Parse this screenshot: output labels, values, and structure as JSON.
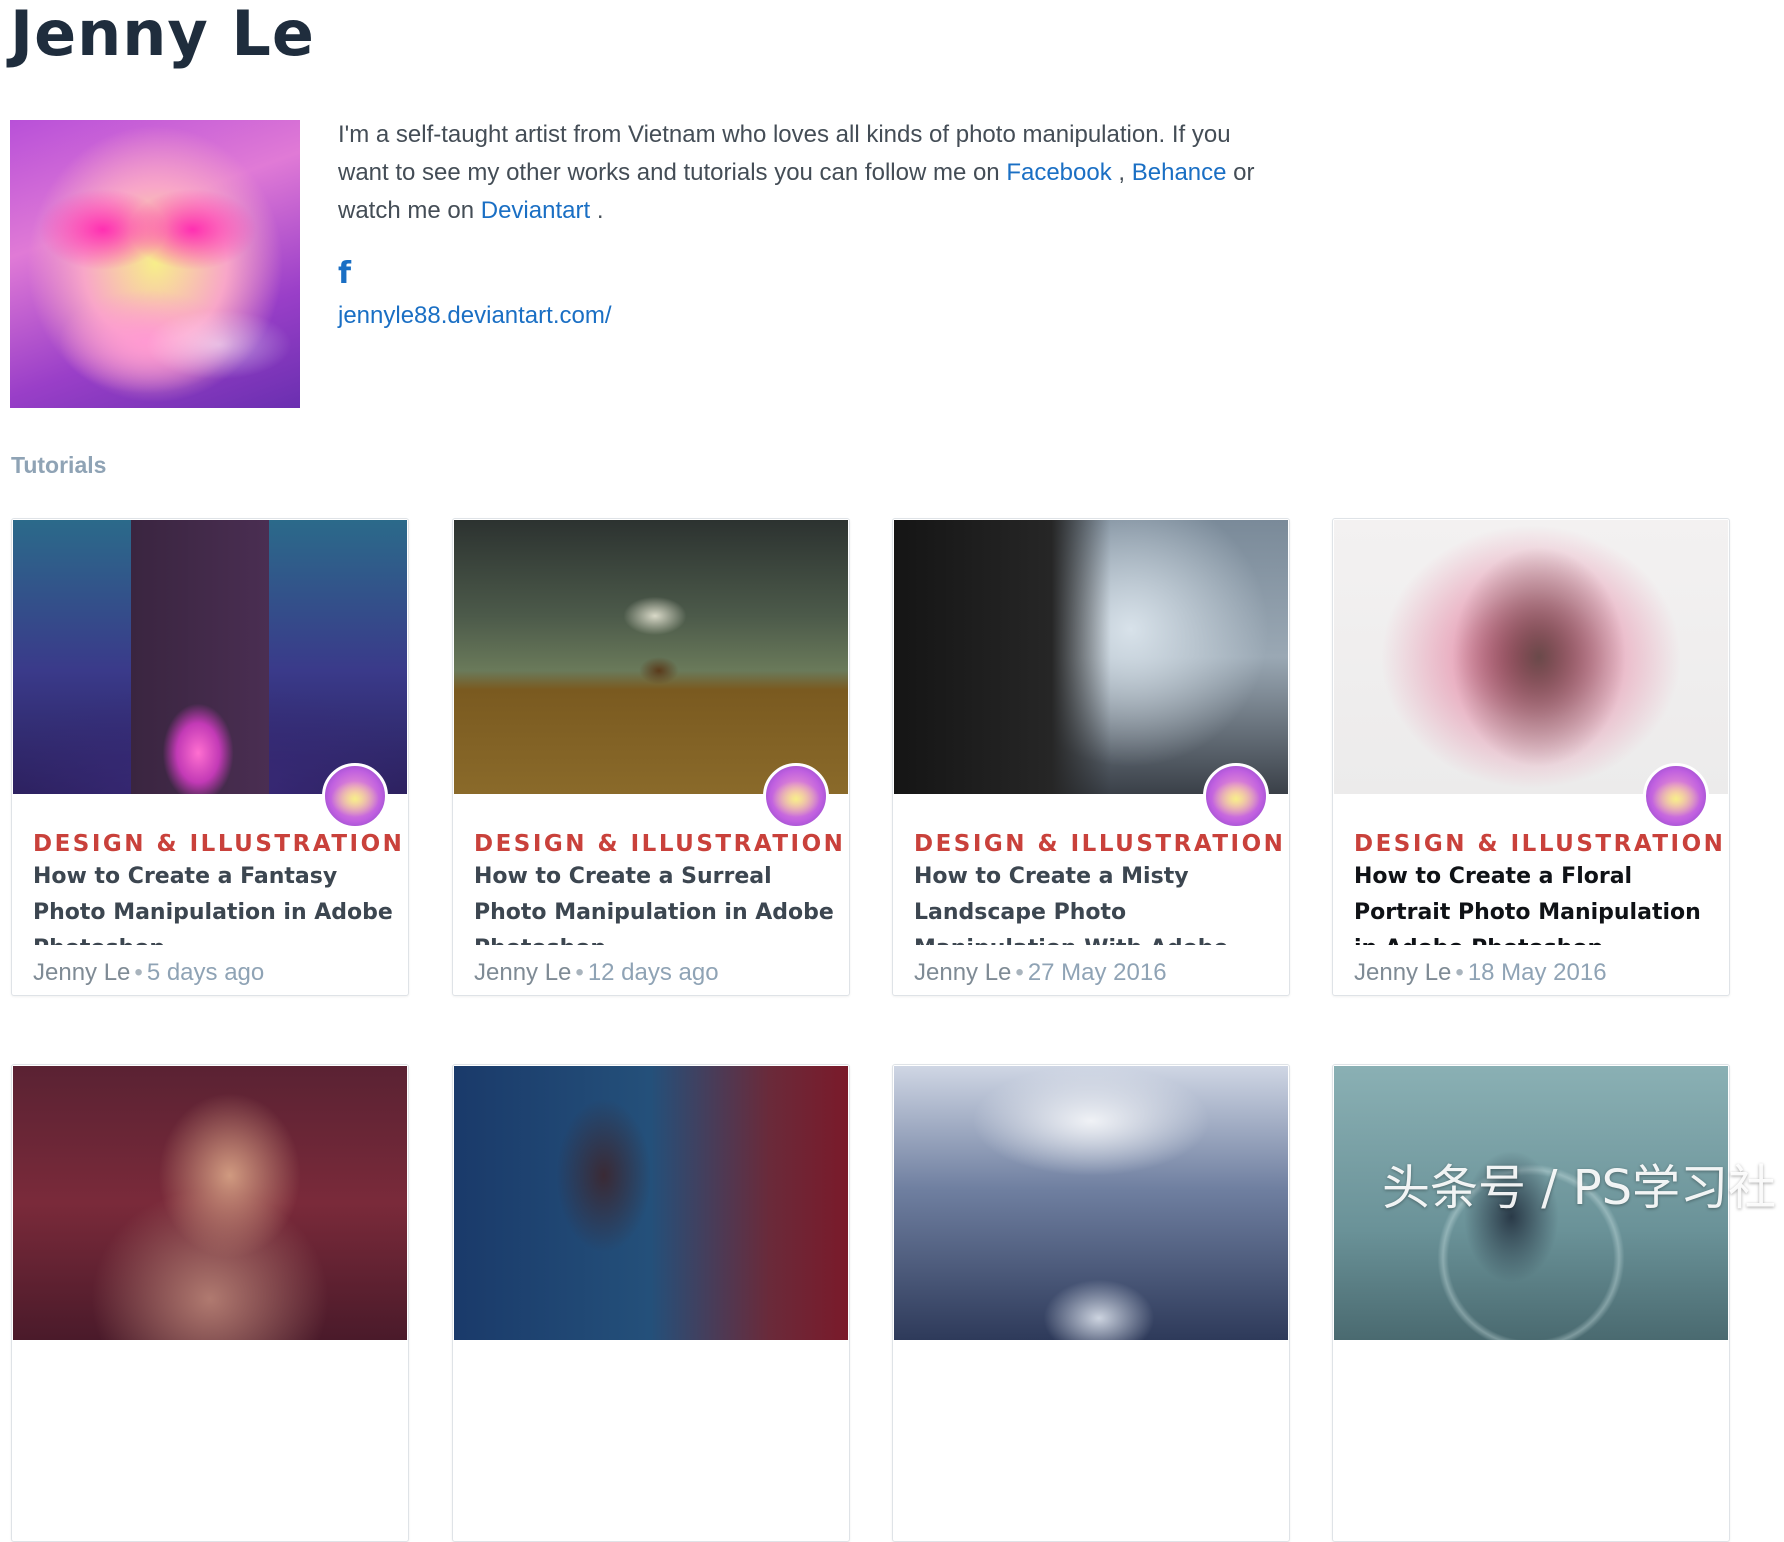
{
  "profile": {
    "name": "Jenny Le",
    "bio_text_1": "I'm a self-taught artist from Vietnam who loves all kinds of photo manipulation. If you want to see my other works and tutorials you can follow me on",
    "bio_link_facebook": "Facebook",
    "bio_sep_1": ",",
    "bio_link_behance": "Behance",
    "bio_text_2": "or watch me on",
    "bio_link_deviantart": "Deviantart",
    "bio_text_end": ".",
    "facebook_icon": "f",
    "website": "jennyle88.deviantart.com/"
  },
  "section": {
    "label": "Tutorials"
  },
  "cards": [
    {
      "category": "DESIGN & ILLUSTRATION",
      "title": "How to Create a Fantasy Photo Manipulation in Adobe Photoshop",
      "author": "Jenny Le",
      "sep": "•",
      "date": "5 days ago"
    },
    {
      "category": "DESIGN & ILLUSTRATION",
      "title": "How to Create a Surreal Photo Manipulation in Adobe Photoshop",
      "author": "Jenny Le",
      "sep": "•",
      "date": "12 days ago"
    },
    {
      "category": "DESIGN & ILLUSTRATION",
      "title": "How to Create a Misty Landscape Photo Manipulation With Adobe Photoshop",
      "author": "Jenny Le",
      "sep": "•",
      "date": "27 May 2016"
    },
    {
      "category": "DESIGN & ILLUSTRATION",
      "title": "How to Create a Floral Portrait Photo Manipulation in Adobe Photoshop",
      "author": "Jenny Le",
      "sep": "•",
      "date": "18 May 2016"
    }
  ],
  "watermark": "头条号 / PS学习社",
  "colors": {
    "category_red": "#c9413b",
    "link_blue": "#1a6fc4",
    "section_label": "#8fa3b5"
  }
}
